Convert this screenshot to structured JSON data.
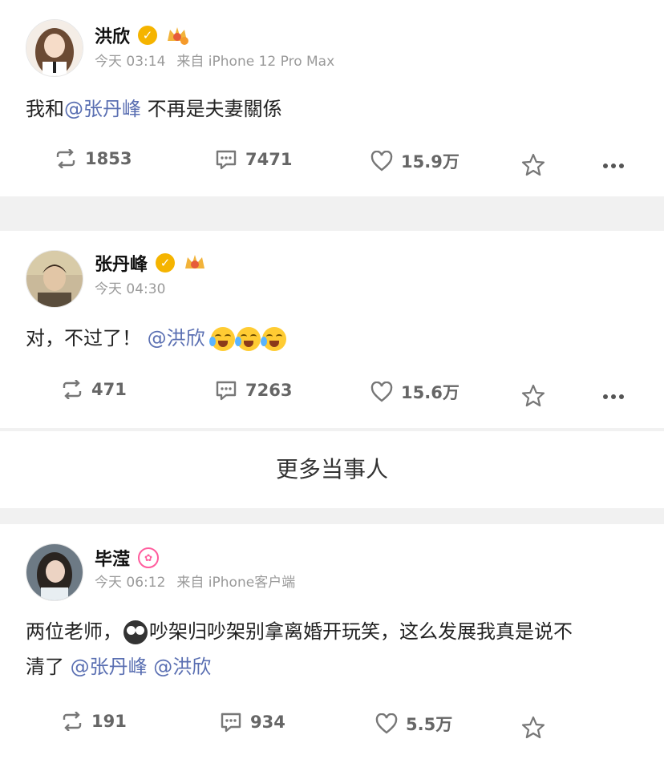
{
  "posts": [
    {
      "name": "洪欣",
      "time": "今天 03:14",
      "source": "来自 iPhone 12 Pro Max",
      "text_prefix": "我和",
      "mention1": "@张丹峰",
      "text_suffix": " 不再是夫妻關係",
      "reposts": "1853",
      "comments": "7471",
      "likes": "15.9万"
    },
    {
      "name": "张丹峰",
      "time": "今天 04:30",
      "text_prefix": "对，不过了！",
      "mention1": "@洪欣",
      "reposts": "471",
      "comments": "7263",
      "likes": "15.6万"
    },
    {
      "name": "毕滢",
      "time": "今天 06:12",
      "source": "来自 iPhone客户端",
      "text_line1_a": "两位老师，",
      "text_line1_b": "吵架归吵架别拿离婚开玩笑，这么发展我真是说不",
      "text_line2": "清了 ",
      "mention1": "@张丹峰",
      "mention2": "@洪欣",
      "reposts": "191",
      "comments": "934",
      "likes": "5.5万"
    }
  ],
  "more_label": "更多当事人",
  "colors": {
    "mention": "#5a6fb2",
    "verified": "#f5b400"
  }
}
